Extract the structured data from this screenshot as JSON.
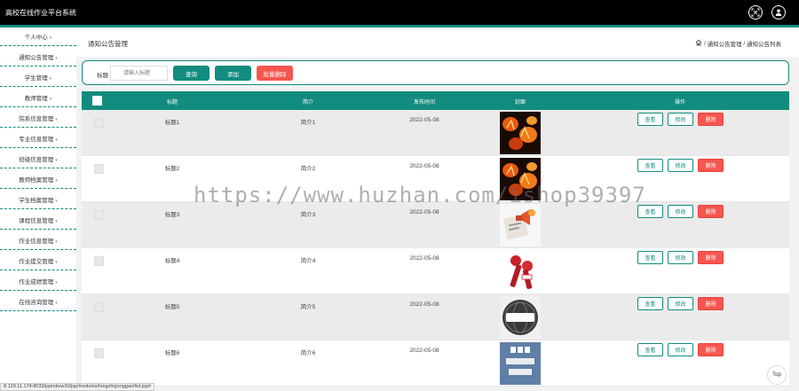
{
  "app": {
    "title": "高校在线作业平台系统",
    "accent_color": "#128c7e",
    "header_bg": "#000000",
    "icons": [
      "fullscreen-icon",
      "user-icon"
    ]
  },
  "sidebar": {
    "items": [
      {
        "label": "个人中心"
      },
      {
        "label": "通知公告管理"
      },
      {
        "label": "学生管理"
      },
      {
        "label": "教师管理"
      },
      {
        "label": "院系信息管理"
      },
      {
        "label": "专业信息管理"
      },
      {
        "label": "班级信息管理"
      },
      {
        "label": "教师档案管理"
      },
      {
        "label": "学生档案管理"
      },
      {
        "label": "课程信息管理"
      },
      {
        "label": "作业信息管理"
      },
      {
        "label": "作业提交管理"
      },
      {
        "label": "作业成绩管理"
      },
      {
        "label": "在线咨询管理"
      }
    ]
  },
  "page": {
    "heading": "通知公告管理",
    "breadcrumb": [
      "通知公告管理",
      "通知公告列表"
    ]
  },
  "search": {
    "label": "标题",
    "placeholder": "请输入标题",
    "query_label": "查询",
    "add_label": "添加",
    "batch_delete_label": "批量删除",
    "danger_color": "#f5564f"
  },
  "table": {
    "headers": {
      "title": "标题",
      "intro": "简介",
      "date": "发布时间",
      "cover": "封面",
      "actions": "操作"
    },
    "rows": [
      {
        "title": "标题1",
        "intro": "简介1",
        "date": "2022-05-08",
        "cover": "fire-letters-image",
        "view": "查看",
        "edit": "修改",
        "delete": "删除"
      },
      {
        "title": "标题2",
        "intro": "简介2",
        "date": "2022-05-08",
        "cover": "fire-letters-image",
        "view": "查看",
        "edit": "修改",
        "delete": "删除"
      },
      {
        "title": "标题3",
        "intro": "简介3",
        "date": "2022-05-08",
        "cover": "megaphone-news-image",
        "view": "查看",
        "edit": "修改",
        "delete": "删除"
      },
      {
        "title": "标题4",
        "intro": "简介4",
        "date": "2022-05-08",
        "cover": "microphone-live-image",
        "view": "查看",
        "edit": "修改",
        "delete": "删除"
      },
      {
        "title": "标题5",
        "intro": "简介5",
        "date": "2022-05-08",
        "cover": "news-globe-image",
        "view": "查看",
        "edit": "修改",
        "delete": "删除"
      },
      {
        "title": "标题6",
        "intro": "简介6",
        "date": "2022-05-08",
        "cover": "bbc-world-news-image",
        "view": "查看",
        "edit": "修改",
        "delete": "删除"
      }
    ]
  },
  "overlay": {
    "watermark": "https://www.huzhan.com/ishop39397",
    "status_url": "8.129.11.174:8033/jspmbcw30/jsp/modules/tongzhigonggao/list.jsp#",
    "top_label": "Top"
  }
}
